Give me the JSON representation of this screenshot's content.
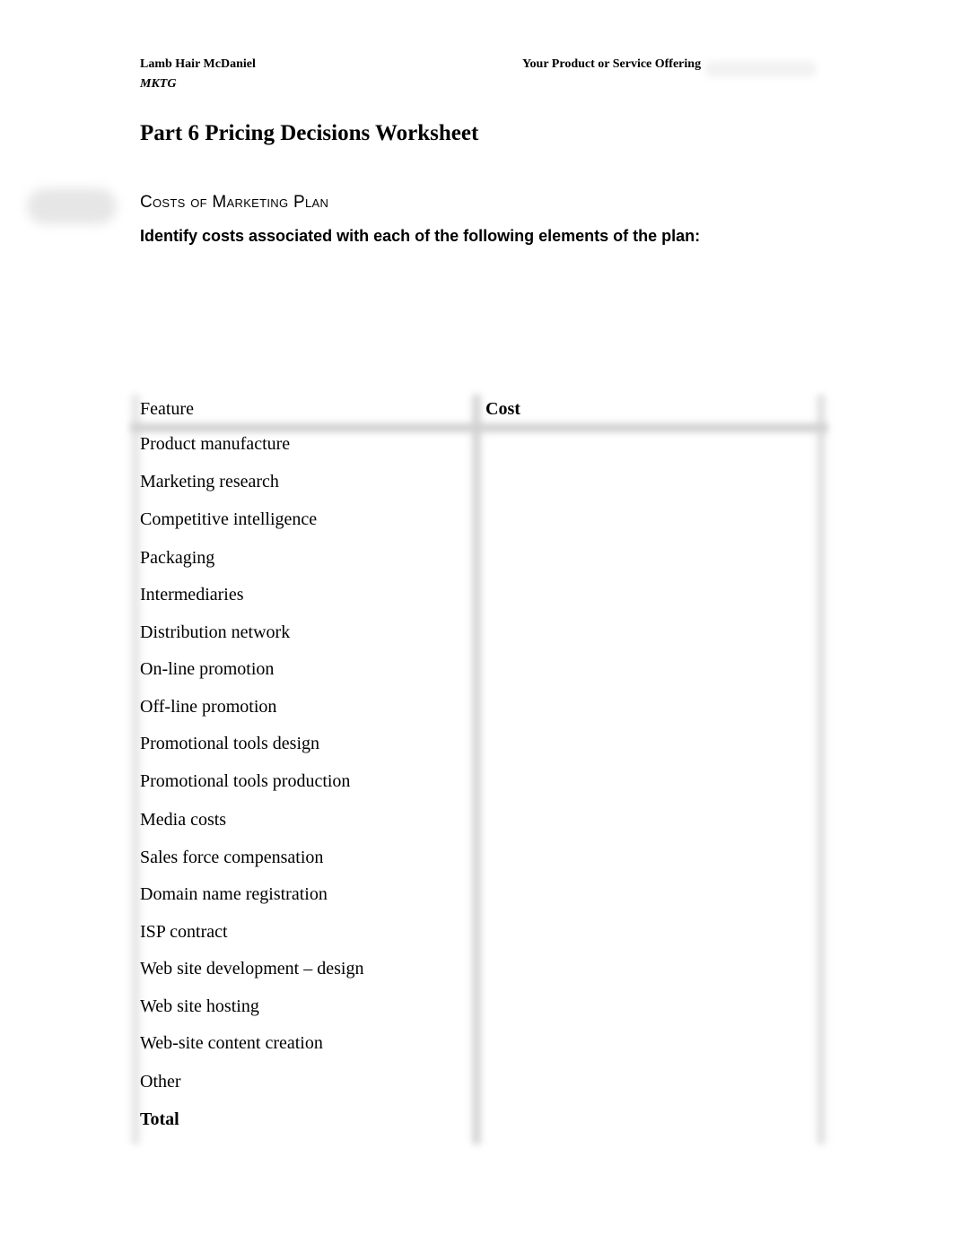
{
  "header": {
    "authors": "Lamb Hair McDaniel",
    "book": "MKTG",
    "right_label": "Your Product or Service Offering"
  },
  "title": "Part 6 Pricing Decisions Worksheet",
  "section_title": "Costs of Marketing Plan",
  "instructions": "Identify costs associated with each of the following elements of the plan:",
  "table": {
    "columns": [
      "Feature",
      "Cost"
    ],
    "rows": [
      {
        "feature": "Product manufacture",
        "cost": ""
      },
      {
        "feature": "Marketing research",
        "cost": ""
      },
      {
        "feature": "Competitive intelligence",
        "cost": ""
      },
      {
        "feature": "Packaging",
        "cost": ""
      },
      {
        "feature": "Intermediaries",
        "cost": ""
      },
      {
        "feature": "Distribution network",
        "cost": ""
      },
      {
        "feature": "On-line promotion",
        "cost": ""
      },
      {
        "feature": "Off-line promotion",
        "cost": ""
      },
      {
        "feature": "Promotional tools design",
        "cost": ""
      },
      {
        "feature": "Promotional tools production",
        "cost": ""
      },
      {
        "feature": "Media costs",
        "cost": ""
      },
      {
        "feature": "Sales force compensation",
        "cost": ""
      },
      {
        "feature": "Domain name registration",
        "cost": ""
      },
      {
        "feature": "ISP contract",
        "cost": ""
      },
      {
        "feature": "Web site development – design",
        "cost": ""
      },
      {
        "feature": "Web site hosting",
        "cost": ""
      },
      {
        "feature": "Web-site content creation",
        "cost": ""
      },
      {
        "feature": "Other",
        "cost": ""
      }
    ],
    "total_label": "Total",
    "total_value": ""
  }
}
